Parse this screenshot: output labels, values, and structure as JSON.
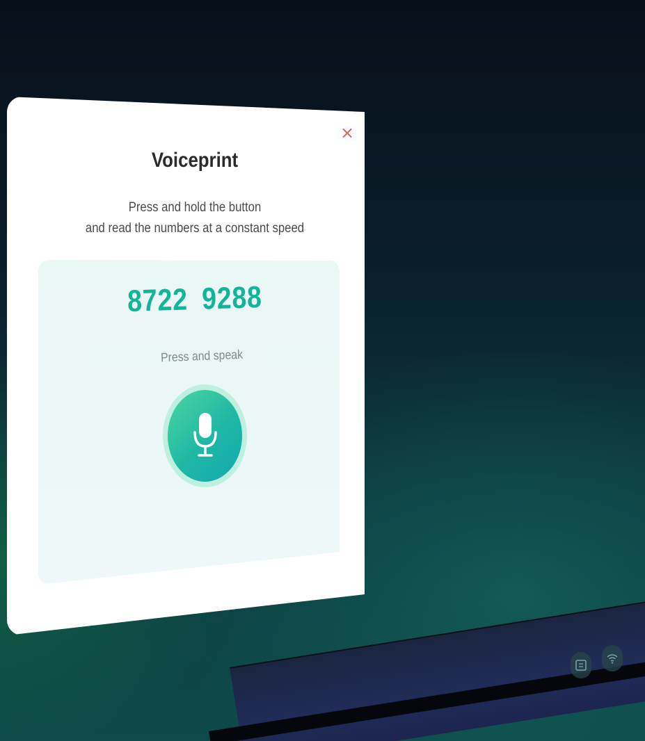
{
  "dialog": {
    "title": "Voiceprint",
    "close_symbol": "×",
    "instructions": [
      "Press and hold the button",
      "and read the numbers at a constant speed"
    ],
    "numbers": [
      "8722",
      "9288"
    ],
    "hint": "Press and speak",
    "mic_icon": "microphone-icon",
    "accent_color": "#12b49a",
    "close_color": "#e0605a"
  },
  "taskbar": {
    "icons": [
      "screen-share-icon",
      "wifi-icon"
    ]
  }
}
